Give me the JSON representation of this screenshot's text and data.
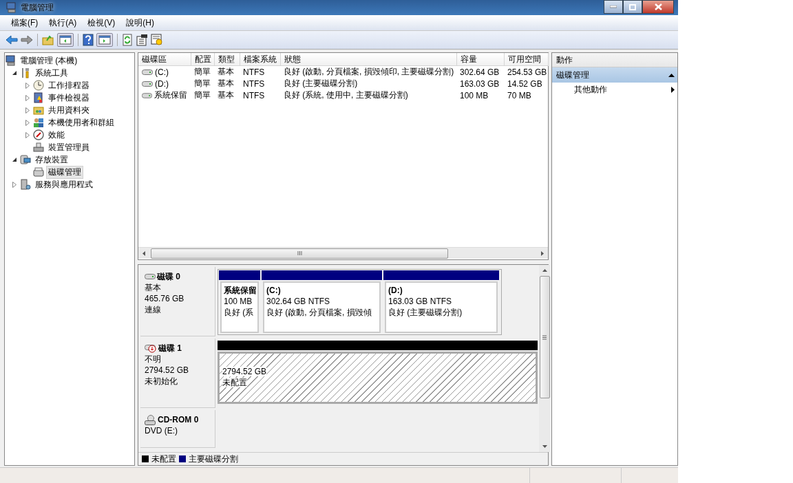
{
  "window": {
    "title": "電腦管理"
  },
  "menu": [
    {
      "label": "檔案(F)"
    },
    {
      "label": "執行(A)"
    },
    {
      "label": "檢視(V)"
    },
    {
      "label": "說明(H)"
    }
  ],
  "tree": [
    {
      "label": "電腦管理 (本機)",
      "kind": "computer",
      "expandable": false,
      "selected": false,
      "children": [
        {
          "label": "系統工具",
          "kind": "tools",
          "expandable": true,
          "expanded": true,
          "selected": false,
          "children": [
            {
              "label": "工作排程器",
              "kind": "clock",
              "expandable": true,
              "expanded": false,
              "selected": false
            },
            {
              "label": "事件檢視器",
              "kind": "log",
              "expandable": true,
              "expanded": false,
              "selected": false
            },
            {
              "label": "共用資料夾",
              "kind": "share",
              "expandable": true,
              "expanded": false,
              "selected": false
            },
            {
              "label": "本機使用者和群組",
              "kind": "users",
              "expandable": true,
              "expanded": false,
              "selected": false
            },
            {
              "label": "效能",
              "kind": "perf",
              "expandable": true,
              "expanded": false,
              "selected": false
            },
            {
              "label": "裝置管理員",
              "kind": "device",
              "expandable": false,
              "selected": false
            }
          ]
        },
        {
          "label": "存放裝置",
          "kind": "storage",
          "expandable": true,
          "expanded": true,
          "selected": false,
          "children": [
            {
              "label": "磁碟管理",
              "kind": "diskmgmt",
              "expandable": false,
              "selected": true
            }
          ]
        },
        {
          "label": "服務與應用程式",
          "kind": "services",
          "expandable": true,
          "expanded": false,
          "selected": false
        }
      ]
    }
  ],
  "table": {
    "columns": [
      "磁碟區",
      "配置",
      "類型",
      "檔案系統",
      "狀態",
      "容量",
      "可用空間"
    ],
    "rows": [
      {
        "cells": [
          "(C:)",
          "簡單",
          "基本",
          "NTFS",
          "良好 (啟動, 分頁檔案, 損毀傾印, 主要磁碟分割)",
          "302.64 GB",
          "254.53 GB"
        ]
      },
      {
        "cells": [
          "(D:)",
          "簡單",
          "基本",
          "NTFS",
          "良好 (主要磁碟分割)",
          "163.03 GB",
          "14.52 GB"
        ]
      },
      {
        "cells": [
          "系統保留",
          "簡單",
          "基本",
          "NTFS",
          "良好 (系統, 使用中, 主要磁碟分割)",
          "100 MB",
          "70 MB"
        ]
      }
    ]
  },
  "disks": [
    {
      "kind": "disk",
      "name": "磁碟 0",
      "lines": [
        "基本",
        "465.76 GB",
        "連線"
      ],
      "partitions": [
        {
          "kind": "primary",
          "color": "#000080",
          "name": "系統保留",
          "size": "100 MB",
          "status": "良好 (系"
        },
        {
          "kind": "primary",
          "color": "#000080",
          "name": "(C:)",
          "size": "302.64 GB NTFS",
          "status": "良好 (啟動, 分頁檔案, 損毀傾"
        },
        {
          "kind": "primary",
          "color": "#000080",
          "name": "(D:)",
          "size": "163.03 GB NTFS",
          "status": "良好 (主要磁碟分割)"
        }
      ]
    },
    {
      "kind": "unknown",
      "name": "磁碟 1",
      "lines": [
        "不明",
        "2794.52 GB",
        "未初始化"
      ],
      "partitions": [
        {
          "kind": "unallocated",
          "color": "#000000",
          "size": "2794.52 GB",
          "status": "未配置"
        }
      ]
    },
    {
      "kind": "cdrom",
      "name": "CD-ROM 0",
      "lines": [
        "DVD (E:)"
      ]
    }
  ],
  "legend": [
    {
      "label": "未配置",
      "color": "#000000"
    },
    {
      "label": "主要磁碟分割",
      "color": "#000080"
    }
  ],
  "actions": {
    "title": "動作",
    "sections": [
      {
        "label": "磁碟管理",
        "expanded": true,
        "items": [
          {
            "label": "其他動作"
          }
        ]
      }
    ]
  }
}
